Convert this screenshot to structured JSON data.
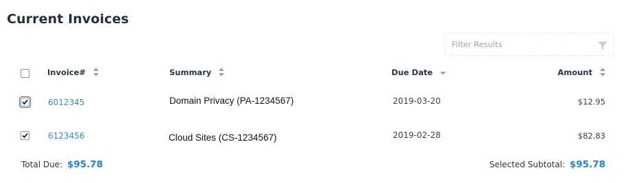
{
  "page": {
    "title": "Current Invoices"
  },
  "filter": {
    "placeholder": "Filter Results",
    "icon": "filter-icon"
  },
  "table": {
    "headers": {
      "invoice": "Invoice#",
      "summary": "Summary",
      "due_date": "Due Date",
      "amount": "Amount"
    },
    "sort_active": "due_date",
    "rows": [
      {
        "checked": true,
        "invoice": "6012345",
        "summary": "Domain Privacy (PA-1234567)",
        "due_date": "2019-03-20",
        "amount": "$12.95"
      },
      {
        "checked": true,
        "invoice": "6123456",
        "summary": "Cloud Sites (CS-1234567)",
        "due_date": "2019-02-28",
        "amount": "$82.83"
      }
    ]
  },
  "footer": {
    "total_label": "Total Due:",
    "total_value": "$95.78",
    "subtotal_label": "Selected Subtotal:",
    "subtotal_value": "$95.78"
  },
  "colors": {
    "link": "#2a8ddc",
    "accent": "#1a86dd",
    "sort_icon": "#8fa3d8"
  }
}
